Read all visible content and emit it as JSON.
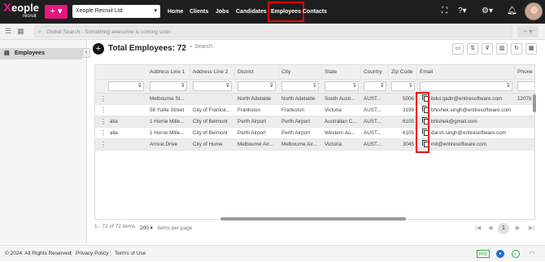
{
  "app": {
    "brand": "Xeople",
    "brand_x": "X",
    "brand_rest": "eople",
    "sub": "recruit",
    "company": "Xeople Recruit Ltd",
    "plus": "+ ▾"
  },
  "nav": [
    {
      "label": "Home"
    },
    {
      "label": "Clients"
    },
    {
      "label": "Jobs"
    },
    {
      "label": "Candidates"
    },
    {
      "label": "Employees",
      "active": true
    },
    {
      "label": "Contacts"
    }
  ],
  "search": {
    "placeholder": "Global Search - Something awesome is coming soon"
  },
  "sidebar": {
    "items": [
      {
        "label": "Employees"
      }
    ]
  },
  "page": {
    "title": "Total Employees: 72",
    "search_placeholder": "Search"
  },
  "grid": {
    "columns": [
      "Address Line 1",
      "Address Line 2",
      "District",
      "City",
      "State",
      "Country",
      "Zip Code",
      "Email",
      "Phone"
    ],
    "rows": [
      {
        "pre": "",
        "addr1": "Melbourne St...",
        "addr2": "",
        "district": "North Adelaide",
        "city": "North Adelaide",
        "state": "South Austr...",
        "country": "AUST...",
        "zip": "5006",
        "email": "bdul.qadir@entiresoftware.com",
        "phone": "12078"
      },
      {
        "pre": "",
        "addr1": "58 Yuille Street",
        "addr2": "City of Frankst...",
        "district": "Frankston",
        "city": "Frankston",
        "state": "Victoria",
        "country": "AUST...",
        "zip": "3199",
        "email": "bhishek.singh@entiresoftware.com",
        "phone": ""
      },
      {
        "pre": "alia",
        "addr1": "1 Horrie Mille...",
        "addr2": "City of Belmont",
        "district": "Perth Airport",
        "city": "Perth Airport",
        "state": "Australian C...",
        "country": "AUST...",
        "zip": "6105",
        "email": "bhishek@gmail.com",
        "phone": ""
      },
      {
        "pre": "alia",
        "addr1": "1 Horrie Mille...",
        "addr2": "City of Belmont",
        "district": "Perth Airport",
        "city": "Perth Airport",
        "state": "Western Au...",
        "country": "AUST...",
        "zip": "6105",
        "email": "darsh.singh@entiresoftware.com",
        "phone": ""
      },
      {
        "pre": "",
        "addr1": "Arrival Drive",
        "addr2": "City of Hume",
        "district": "Melbourne Air...",
        "city": "Melbourne Air...",
        "state": "Victoria",
        "country": "AUST...",
        "zip": "3045",
        "email": "mit@entiresoftware.com",
        "phone": ""
      }
    ]
  },
  "pager": {
    "range": "1 - 72 of 72 items",
    "size": "200",
    "per_page": "items per page",
    "page": "1"
  },
  "footer": {
    "copyright": "© 2024. All Rights Reserved",
    "privacy": "Privacy Policy",
    "terms": "Terms of Use",
    "ppd": "PPD"
  }
}
